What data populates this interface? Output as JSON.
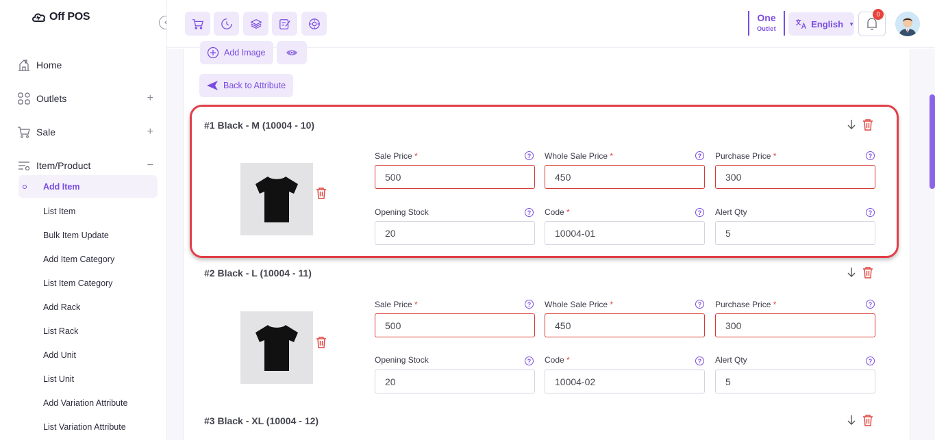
{
  "app": {
    "logo_text": "Off POS"
  },
  "sidebar": {
    "items": [
      {
        "label": "Home",
        "icon": "home-icon",
        "toggle": ""
      },
      {
        "label": "Outlets",
        "icon": "grid-icon",
        "toggle": "+"
      },
      {
        "label": "Sale",
        "icon": "cart-icon",
        "toggle": "+"
      },
      {
        "label": "Item/Product",
        "icon": "list-settings-icon",
        "toggle": "−"
      }
    ],
    "submenu": [
      {
        "label": "Add Item",
        "active": true
      },
      {
        "label": "List Item"
      },
      {
        "label": "Bulk Item Update"
      },
      {
        "label": "Add Item Category"
      },
      {
        "label": "List Item Category"
      },
      {
        "label": "Add Rack"
      },
      {
        "label": "List Rack"
      },
      {
        "label": "Add Unit"
      },
      {
        "label": "List Unit"
      },
      {
        "label": "Add Variation Attribute"
      },
      {
        "label": "List Variation Attribute"
      }
    ]
  },
  "topbar": {
    "quick_icons": [
      "cart-icon",
      "clock-icon",
      "layers-icon",
      "edit-icon",
      "compass-icon"
    ],
    "outlet": {
      "name": "One",
      "caption": "Outlet"
    },
    "language": "English",
    "notifications": "0"
  },
  "actions": {
    "add_image": "Add Image",
    "back": "Back to Attribute"
  },
  "fields": {
    "sale_price": "Sale Price",
    "wholesale_price": "Whole Sale Price",
    "purchase_price": "Purchase Price",
    "opening_stock": "Opening Stock",
    "code": "Code",
    "alert_qty": "Alert Qty",
    "required_mark": "*",
    "help_glyph": "?"
  },
  "variants": [
    {
      "title": "#1 Black - M (10004 - 10)",
      "sale_price": "500",
      "wholesale_price": "450",
      "purchase_price": "300",
      "opening_stock": "20",
      "code": "10004-01",
      "alert_qty": "5"
    },
    {
      "title": "#2 Black - L (10004 - 11)",
      "sale_price": "500",
      "wholesale_price": "450",
      "purchase_price": "300",
      "opening_stock": "20",
      "code": "10004-02",
      "alert_qty": "5"
    },
    {
      "title": "#3 Black - XL (10004 - 12)"
    }
  ],
  "colors": {
    "accent": "#7a4ce0",
    "highlight": "#e23e48",
    "error": "#d63a34"
  }
}
